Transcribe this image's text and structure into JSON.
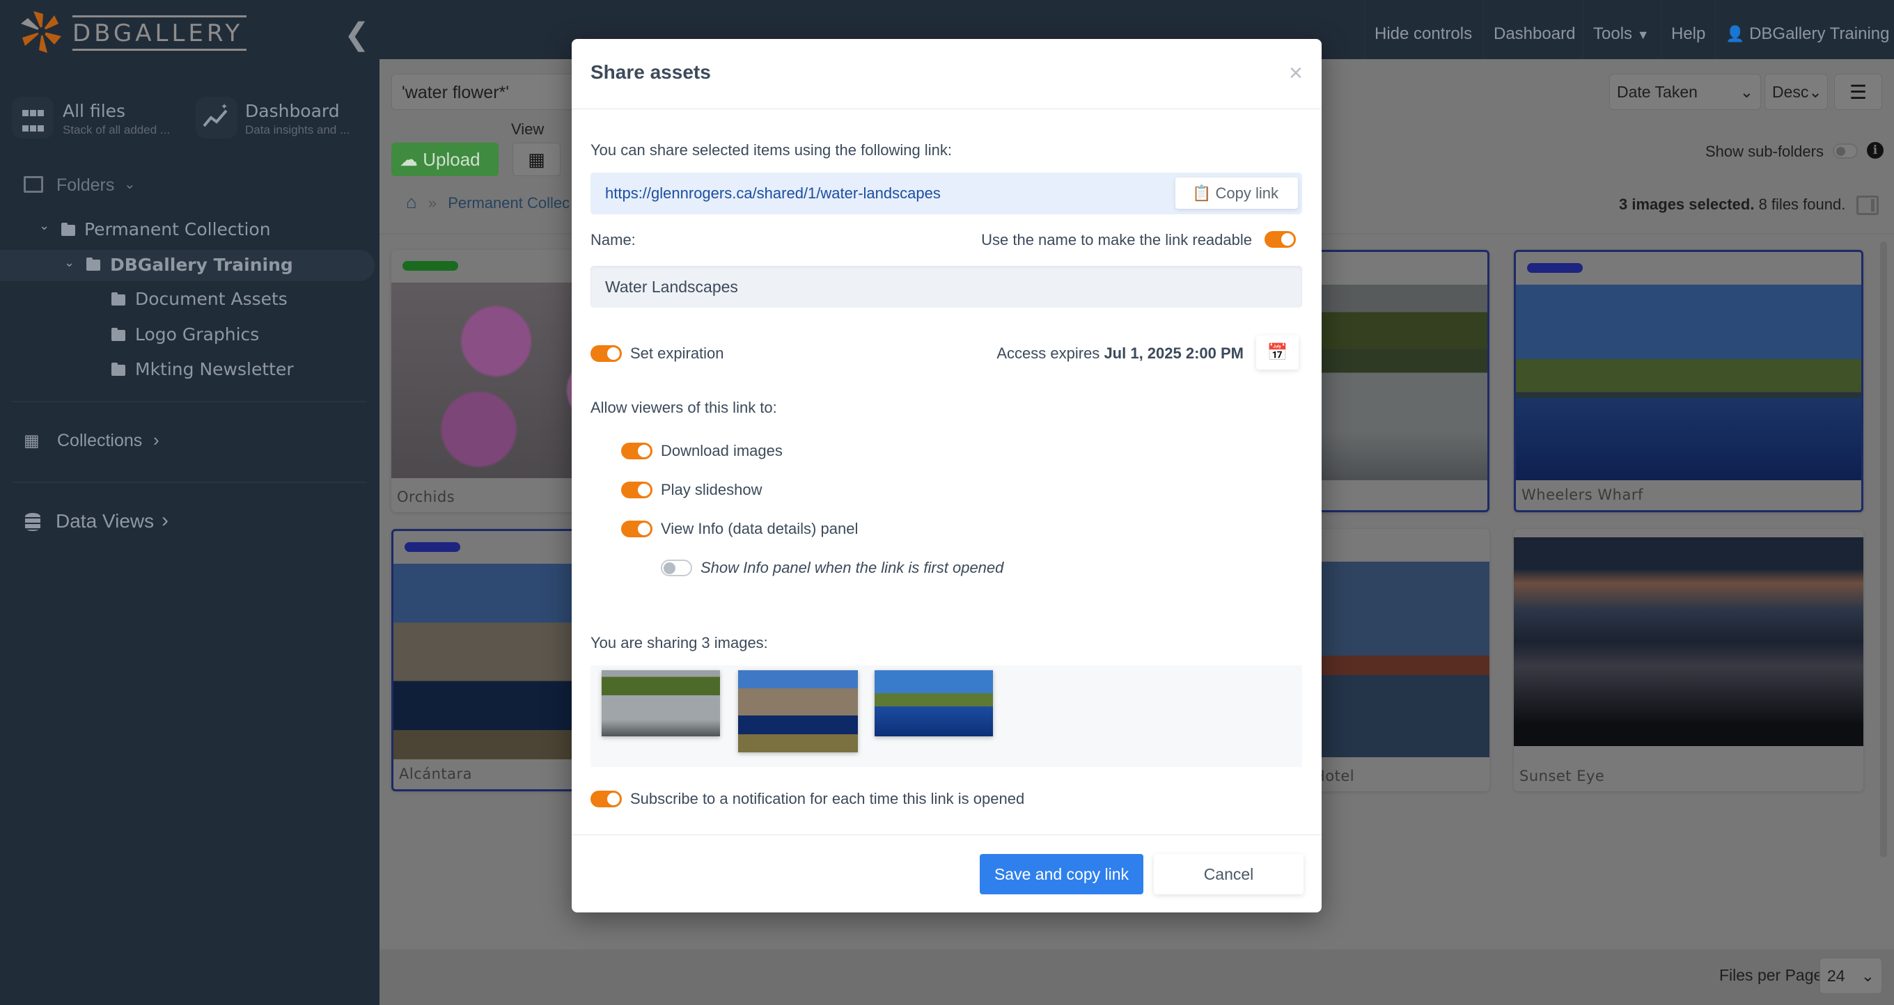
{
  "app": {
    "logo_text": "DBGALLERY"
  },
  "sidebar": {
    "tiles": [
      {
        "title": "All files",
        "subtitle": "Stack of all added ...",
        "icon": "grid-icon"
      },
      {
        "title": "Dashboard",
        "subtitle": "Data insights and ...",
        "icon": "chart-sparkle-icon"
      }
    ],
    "folders_label": "Folders",
    "tree": [
      {
        "label": "Permanent Collection",
        "expanded": true
      },
      {
        "label": "DBGallery Training",
        "expanded": true,
        "selected": true
      },
      {
        "label": "Document Assets"
      },
      {
        "label": "Logo Graphics"
      },
      {
        "label": "Mkting Newsletter"
      }
    ],
    "collections_label": "Collections",
    "data_views_label": "Data Views"
  },
  "topnav": {
    "items": [
      "Hide controls",
      "Dashboard",
      "Tools",
      "Help"
    ],
    "user": "DBGallery Training"
  },
  "toolbar": {
    "search_value": "'water flower*'",
    "view_label": "View",
    "upload_label": "Upload",
    "breadcrumb": [
      "Permanent Collec"
    ],
    "sort_field": "Date Taken",
    "sort_order": "Desc",
    "show_subfolders_label": "Show sub-folders",
    "show_subfolders": false,
    "selected_count": "3 images selected.",
    "found_count": "8 files found."
  },
  "gallery": {
    "cards": [
      {
        "label": "Orchids",
        "tag_color": "#1a6b1f",
        "selected": false
      },
      {
        "label": "Alcántara",
        "tag_color": "#1d2580",
        "selected": true
      },
      {
        "label": "",
        "tag_color": "",
        "selected": true
      },
      {
        "label": "Hotel",
        "tag_color": "",
        "selected": false
      },
      {
        "label": "Wheelers Wharf",
        "tag_color": "#1d2580",
        "selected": true
      },
      {
        "label": "Sunset Eye",
        "tag_color": "#1d2580",
        "selected": false
      }
    ]
  },
  "footer": {
    "files_per_page_label": "Files per Page",
    "files_per_page": "24"
  },
  "modal": {
    "title": "Share assets",
    "close": "×",
    "intro": "You can share selected items using the following link:",
    "link": "https://glennrogers.ca/shared/1/water-landscapes",
    "copy_label": "Copy link",
    "name_label": "Name:",
    "readable_label": "Use the name to make the link readable",
    "readable": true,
    "name_value": "Water Landscapes",
    "expiration_label": "Set expiration",
    "expiration": true,
    "expires_prefix": "Access expires",
    "expires_value": "Jul 1, 2025 2:00 PM",
    "allow_label": "Allow viewers of this link to:",
    "permissions": [
      {
        "label": "Download images",
        "on": true
      },
      {
        "label": "Play slideshow",
        "on": true
      },
      {
        "label": "View Info (data details) panel",
        "on": true
      }
    ],
    "show_info_label": "Show Info panel when the link is first opened",
    "show_info": false,
    "sharing_label": "You are sharing 3 images:",
    "subscribe_label": "Subscribe to a notification for each time this link is opened",
    "subscribe": true,
    "save_label": "Save and copy link",
    "cancel_label": "Cancel"
  },
  "colors": {
    "accent": "#f07d0f",
    "primary": "#2f80ed",
    "link": "#1d4ea0",
    "upload": "#3f8b3f"
  }
}
